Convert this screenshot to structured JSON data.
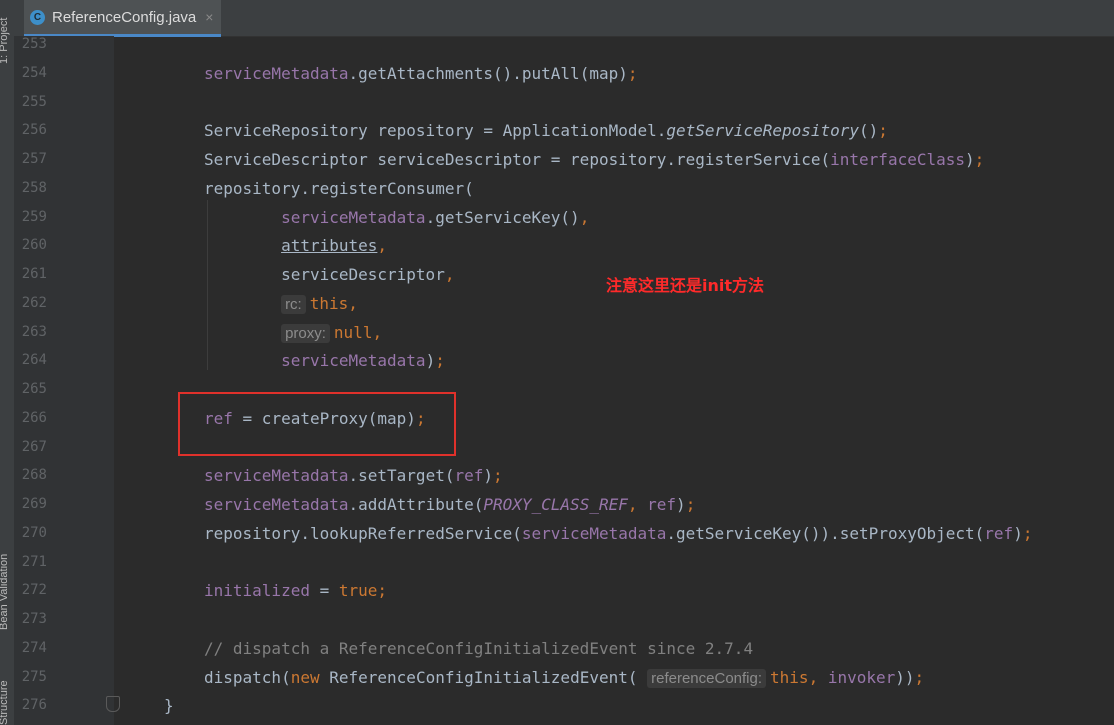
{
  "sidebar": {
    "project": "1: Project",
    "bean_validation": "Bean Validation",
    "structure": "Structure"
  },
  "tab": {
    "title": "ReferenceConfig.java",
    "close": "×",
    "icon": "C"
  },
  "annotation": "注意这里还是init方法",
  "lines": [
    {
      "n": "253"
    },
    {
      "n": "254"
    },
    {
      "n": "255"
    },
    {
      "n": "256"
    },
    {
      "n": "257"
    },
    {
      "n": "258"
    },
    {
      "n": "259"
    },
    {
      "n": "260"
    },
    {
      "n": "261"
    },
    {
      "n": "262",
      "hint": "rc:"
    },
    {
      "n": "263",
      "hint": "proxy:"
    },
    {
      "n": "264"
    },
    {
      "n": "265"
    },
    {
      "n": "266"
    },
    {
      "n": "267"
    },
    {
      "n": "268"
    },
    {
      "n": "269"
    },
    {
      "n": "270"
    },
    {
      "n": "271"
    },
    {
      "n": "272"
    },
    {
      "n": "273"
    },
    {
      "n": "274"
    },
    {
      "n": "275",
      "hint": "referenceConfig:"
    },
    {
      "n": "276"
    }
  ],
  "colors": {
    "highlight_box": "#e0312b",
    "annotation": "#ff2a2a",
    "field": "#9876aa",
    "keyword": "#cc7832",
    "comment": "#808080",
    "text": "#a9b7c6"
  }
}
